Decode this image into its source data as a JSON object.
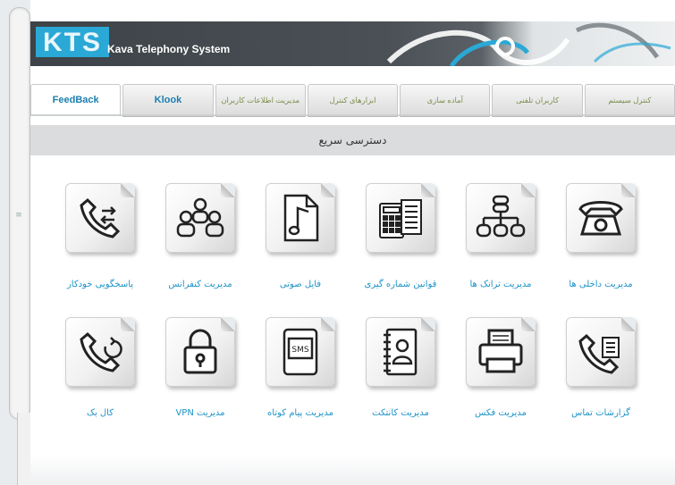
{
  "header": {
    "logo": "KTS",
    "subtitle": "Kava Telephony System"
  },
  "tabs": [
    {
      "label": "FeedBack"
    },
    {
      "label": "Klook"
    },
    {
      "label": "مدیریت اطلاعات کاربران"
    },
    {
      "label": "ابزارهای کنترل"
    },
    {
      "label": "آماده سازی"
    },
    {
      "label": "کاربران تلفنی"
    },
    {
      "label": "کنترل سیستم"
    }
  ],
  "quick_access": {
    "title": "دسترسی سریع"
  },
  "grid": [
    {
      "label": "پاسخگویی خودکار",
      "icon": "auto-answer-icon"
    },
    {
      "label": "مدیریت کنفرانس",
      "icon": "conference-icon"
    },
    {
      "label": "فایل صوتی",
      "icon": "audio-file-icon"
    },
    {
      "label": "قوانین شماره گیری",
      "icon": "dial-rules-icon"
    },
    {
      "label": "مدیریت ترانک ها",
      "icon": "trunk-icon"
    },
    {
      "label": "مدیریت داخلی ها",
      "icon": "extension-phone-icon"
    },
    {
      "label": "کال بک",
      "icon": "callback-icon"
    },
    {
      "label": "مدیریت VPN",
      "icon": "vpn-lock-icon"
    },
    {
      "label": "مدیریت پیام کوتاه",
      "icon": "sms-icon"
    },
    {
      "label": "مدیریت کانتکت",
      "icon": "contacts-book-icon"
    },
    {
      "label": "مدیریت فکس",
      "icon": "fax-printer-icon"
    },
    {
      "label": "گزارشات تماس",
      "icon": "call-report-icon"
    }
  ],
  "sms_icon_text": "SMS"
}
